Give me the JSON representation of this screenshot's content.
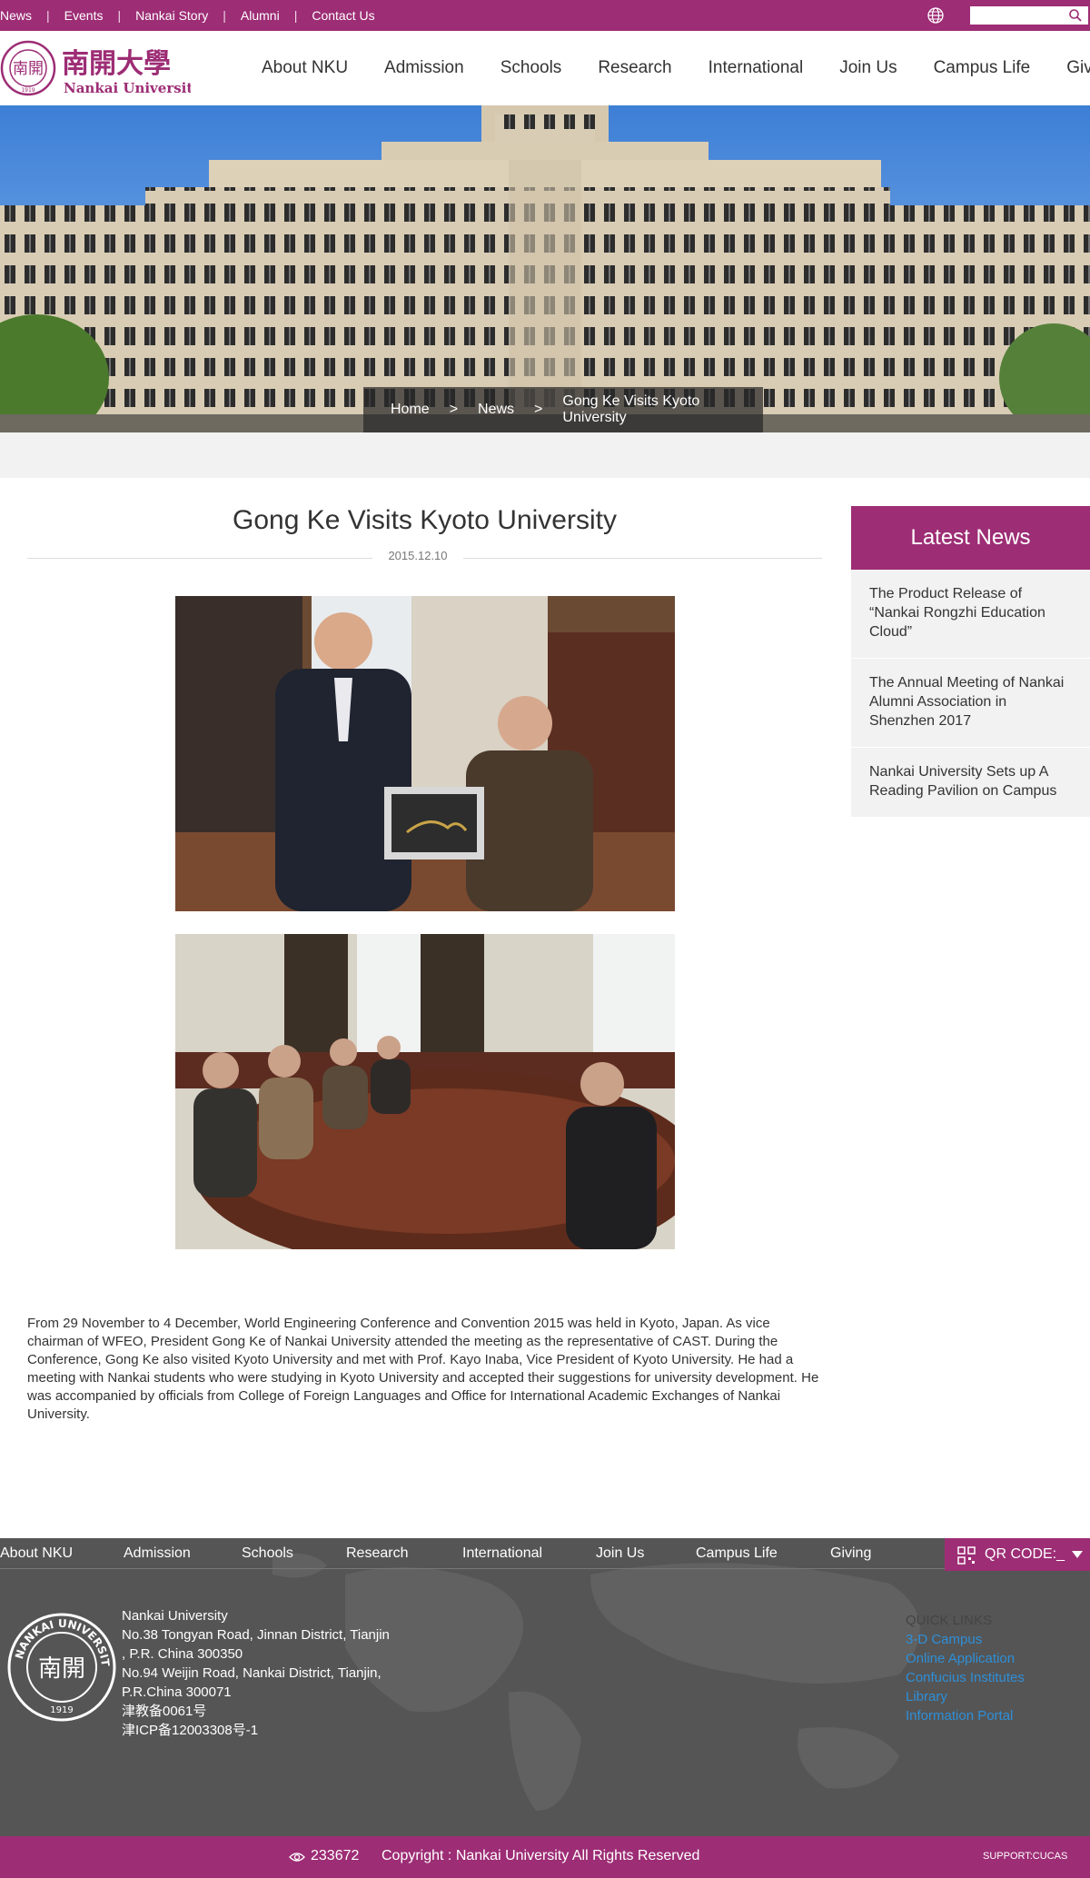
{
  "topbar": {
    "links": [
      "News",
      "Events",
      "Nankai Story",
      "Alumni",
      "Contact Us"
    ],
    "search_placeholder": ""
  },
  "header": {
    "logo_cn": "南開大學",
    "logo_en": "Nankai University",
    "nav": [
      "About NKU",
      "Admission",
      "Schools",
      "Research",
      "International",
      "Join Us",
      "Campus Life",
      "Giving"
    ]
  },
  "breadcrumb": {
    "home": "Home",
    "sep": ">",
    "news": "News",
    "current": "Gong Ke Visits Kyoto University"
  },
  "article": {
    "title": "Gong Ke Visits Kyoto University",
    "date": "2015.12.10",
    "body": "From 29 November to 4 December, World Engineering Conference and Convention 2015 was held in Kyoto, Japan. As vice chairman of WFEO, President Gong Ke of Nankai University attended the meeting as the representative of CAST. During the Conference, Gong Ke also visited Kyoto University and met with Prof. Kayo Inaba, Vice President of Kyoto University. He had a meeting with Nankai students who were studying in Kyoto University and accepted their suggestions for university development. He was accompanied by officials from College of Foreign Languages and Office for International Academic Exchanges of Nankai University."
  },
  "sidebar": {
    "heading": "Latest News",
    "items": [
      "The Product Release of “Nankai Rongzhi Education Cloud”",
      "The Annual Meeting of Nankai Alumni Association in Shenzhen 2017",
      "Nankai University Sets up A Reading Pavilion on Campus"
    ]
  },
  "footer": {
    "nav": [
      "About NKU",
      "Admission",
      "Schools",
      "Research",
      "International",
      "Join Us",
      "Campus Life",
      "Giving"
    ],
    "qr_label": "QR CODE:_",
    "address": [
      "Nankai University",
      "No.38 Tongyan Road, Jinnan District, Tianjin",
      ", P.R. China 300350",
      "No.94 Weijin Road,  Nankai District, Tianjin,",
      "P.R.China  300071",
      "津教备0061号",
      "津ICP备12003308号-1"
    ],
    "quick_links_title": "QUICK LINKS",
    "quick_links": [
      "3-D Campus",
      "Online Application",
      "Confucius Institutes",
      "Library",
      "Information Portal"
    ],
    "visits": "233672",
    "copyright": "Copyright : Nankai University All Rights Reserved",
    "support": "SUPPORT:CUCAS"
  },
  "colors": {
    "brand": "#9d2d75",
    "footer_bg": "#555555",
    "link": "#2e8fd8"
  }
}
